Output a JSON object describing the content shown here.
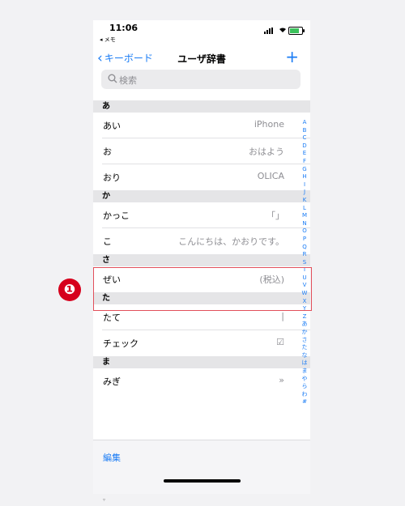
{
  "status": {
    "time": "11:06",
    "back_app": "◂ メモ"
  },
  "nav": {
    "back_label": "キーボード",
    "title": "ユーザ辞書",
    "add_label": "+"
  },
  "search": {
    "placeholder": "検索"
  },
  "sections": [
    {
      "header": "あ",
      "rows": [
        {
          "word": "あい",
          "reading": "iPhone"
        },
        {
          "word": "お",
          "reading": "おはよう"
        },
        {
          "word": "おり",
          "reading": "OLICA"
        }
      ]
    },
    {
      "header": "か",
      "rows": [
        {
          "word": "かっこ",
          "reading": "「」"
        },
        {
          "word": "こ",
          "reading": "こんにちは、かおりです。"
        }
      ]
    },
    {
      "header": "さ",
      "rows": [
        {
          "word": "ぜい",
          "reading": "(税込)"
        }
      ]
    },
    {
      "header": "た",
      "rows": [
        {
          "word": "たて",
          "reading": "|"
        },
        {
          "word": "チェック",
          "reading": "☑"
        }
      ]
    },
    {
      "header": "ま",
      "rows": [
        {
          "word": "みぎ",
          "reading": "»"
        }
      ]
    }
  ],
  "index": [
    "A",
    "B",
    "C",
    "D",
    "E",
    "F",
    "G",
    "H",
    "I",
    "J",
    "K",
    "L",
    "M",
    "N",
    "O",
    "P",
    "Q",
    "R",
    "S",
    "T",
    "U",
    "V",
    "W",
    "X",
    "Y",
    "Z",
    "あ",
    "か",
    "さ",
    "た",
    "な",
    "は",
    "ま",
    "や",
    "ら",
    "わ",
    "#"
  ],
  "bottom": {
    "edit_label": "編集"
  },
  "annotation": {
    "badge": "❶"
  },
  "colors": {
    "accent": "#1a7cf5",
    "highlight": "#e2505b",
    "badge": "#d6001c"
  }
}
